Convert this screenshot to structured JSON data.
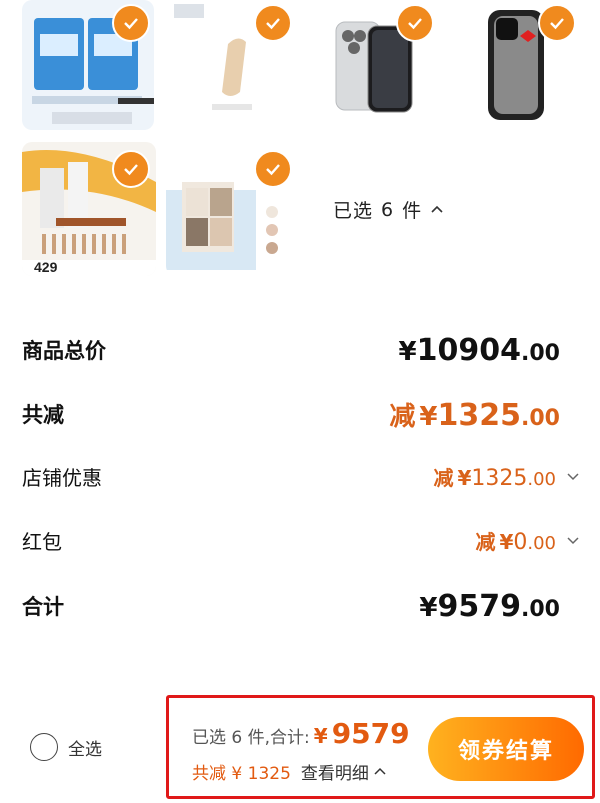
{
  "products": [
    {
      "name": "product-blue-boxes"
    },
    {
      "name": "product-foundation"
    },
    {
      "name": "product-iphone"
    },
    {
      "name": "product-phone-case"
    },
    {
      "name": "product-brush-set",
      "price_tag": "429"
    },
    {
      "name": "product-eyeshadow-palette"
    }
  ],
  "selection": {
    "label": "已选",
    "count": "6",
    "unit": "件"
  },
  "summary": {
    "total_label": "商品总价",
    "total_yen": "¥",
    "total_int": "10904",
    "total_dec": ".00",
    "discount_label": "共减",
    "discount_prefix": "减",
    "discount_yen": "¥",
    "discount_int": "1325",
    "discount_dec": ".00",
    "store_label": "店铺优惠",
    "store_prefix": "减",
    "store_yen": "¥",
    "store_int": "1325",
    "store_dec": ".00",
    "redpacket_label": "红包",
    "redpacket_prefix": "减",
    "redpacket_yen": "¥",
    "redpacket_int": "0",
    "redpacket_dec": ".00",
    "grand_label": "合计",
    "grand_yen": "¥",
    "grand_int": "9579",
    "grand_dec": ".00"
  },
  "bottom": {
    "select_all": "全选",
    "selected_text": "已选 6 件,合计:",
    "total_yen": "¥",
    "total_value": "9579",
    "saved_text": "共减 ¥ 1325",
    "detail_text": "查看明细",
    "checkout": "领券结算"
  },
  "colors": {
    "accent": "#f08a1e",
    "discount": "#d9621a",
    "highlight": "#e01818"
  }
}
